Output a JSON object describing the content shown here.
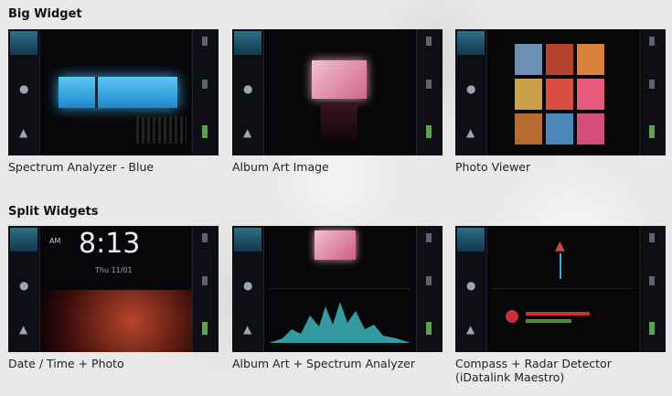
{
  "sections": {
    "big": {
      "title": "Big Widget"
    },
    "split": {
      "title": "Split Widgets"
    }
  },
  "screens": {
    "spectrum_blue": {
      "caption": "Spectrum Analyzer - Blue"
    },
    "album_art": {
      "caption": "Album Art Image"
    },
    "photo_viewer": {
      "caption": "Photo Viewer"
    },
    "date_time_photo": {
      "caption": "Date / Time + Photo",
      "time": "8:13",
      "am_pm": "AM",
      "date": "Thu 11/01"
    },
    "album_spectrum": {
      "caption": "Album Art + Spectrum Analyzer"
    },
    "compass_radar": {
      "caption_line1": "Compass + Radar Detector",
      "caption_line2": "(iDatalink Maestro)"
    }
  },
  "icons": [
    "wave-icon",
    "dot-icon",
    "triangle-icon",
    "bar-icon"
  ],
  "colors": {
    "screen_bg": "#07070a",
    "accent_blue": "#3fa7e0",
    "accent_pink": "#e8a1b4",
    "accent_green": "#5da34f"
  }
}
